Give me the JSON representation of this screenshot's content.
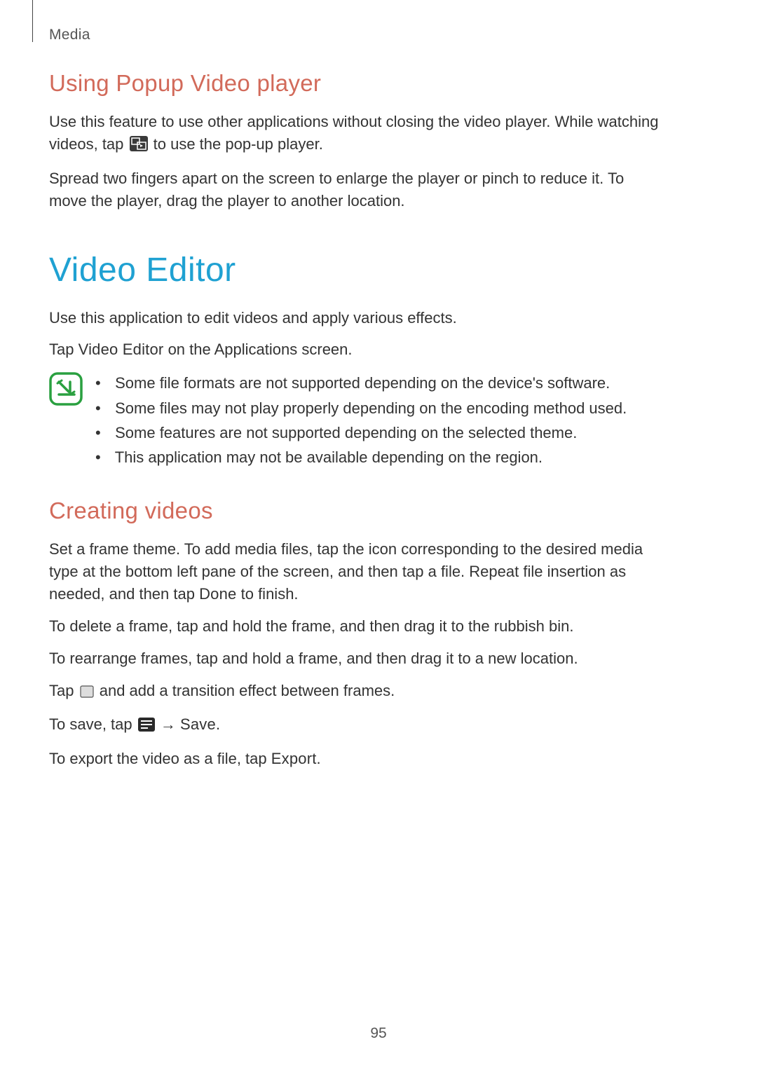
{
  "header": {
    "section": "Media"
  },
  "popup": {
    "heading": "Using Popup Video player",
    "p1_pre": "Use this feature to use other applications without closing the video player. While watching videos, tap ",
    "p1_post": " to use the pop-up player.",
    "p2": "Spread two fingers apart on the screen to enlarge the player or pinch to reduce it. To move the player, drag the player to another location."
  },
  "editor": {
    "heading": "Video Editor",
    "p1": "Use this application to edit videos and apply various effects.",
    "p2_pre": "Tap ",
    "p2_app": "Video Editor",
    "p2_post": " on the Applications screen.",
    "notes": [
      "Some file formats are not supported depending on the device's software.",
      "Some files may not play properly depending on the encoding method used.",
      "Some features are not supported depending on the selected theme.",
      "This application may not be available depending on the region."
    ]
  },
  "creating": {
    "heading": "Creating videos",
    "p1_pre": "Set a frame theme. To add media files, tap the icon corresponding to the desired media type at the bottom left pane of the screen, and then tap a file. Repeat file insertion as needed, and then tap ",
    "p1_done": "Done",
    "p1_post": " to finish.",
    "p2": "To delete a frame, tap and hold the frame, and then drag it to the rubbish bin.",
    "p3": "To rearrange frames, tap and hold a frame, and then drag it to a new location.",
    "p4_pre": "Tap ",
    "p4_post": " and add a transition effect between frames.",
    "p5_pre": "To save, tap ",
    "p5_arrow": " → ",
    "p5_save": "Save",
    "p5_post": ".",
    "p6_pre": "To export the video as a file, tap ",
    "p6_export": "Export",
    "p6_post": "."
  },
  "pageNumber": "95"
}
